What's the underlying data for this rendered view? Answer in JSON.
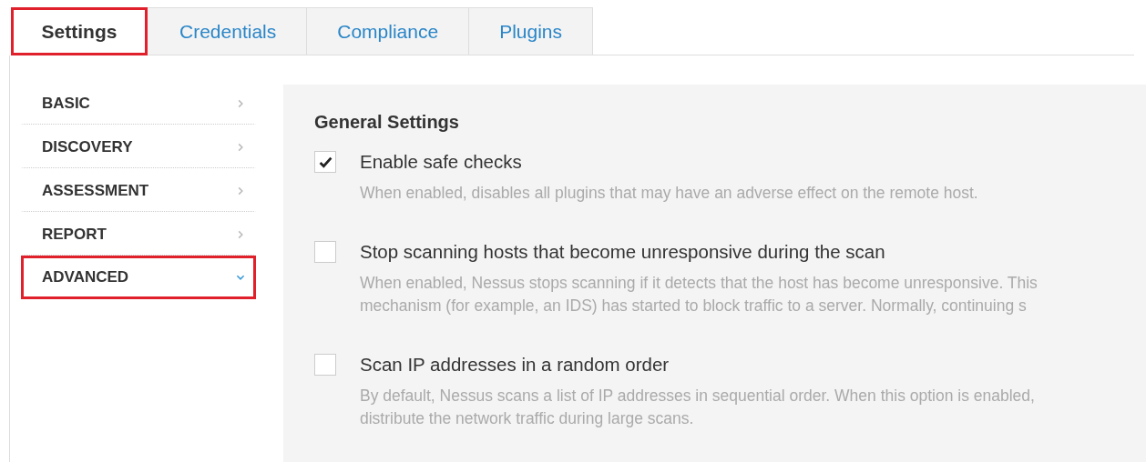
{
  "tabs": [
    {
      "label": "Settings",
      "selected": true,
      "highlighted": true
    },
    {
      "label": "Credentials",
      "selected": false,
      "highlighted": false
    },
    {
      "label": "Compliance",
      "selected": false,
      "highlighted": false
    },
    {
      "label": "Plugins",
      "selected": false,
      "highlighted": false
    }
  ],
  "sidebar": {
    "items": [
      {
        "label": "BASIC",
        "expanded": false,
        "highlighted": false
      },
      {
        "label": "DISCOVERY",
        "expanded": false,
        "highlighted": false
      },
      {
        "label": "ASSESSMENT",
        "expanded": false,
        "highlighted": false
      },
      {
        "label": "REPORT",
        "expanded": false,
        "highlighted": false
      },
      {
        "label": "ADVANCED",
        "expanded": true,
        "highlighted": true
      }
    ]
  },
  "panel": {
    "heading": "General Settings",
    "options": [
      {
        "label": "Enable safe checks",
        "checked": true,
        "description": [
          "When enabled, disables all plugins that may have an adverse effect on the remote host."
        ]
      },
      {
        "label": "Stop scanning hosts that become unresponsive during the scan",
        "checked": false,
        "description": [
          "When enabled, Nessus stops scanning if it detects that the host has become unresponsive. This",
          "mechanism (for example, an IDS) has started to block traffic to a server. Normally, continuing s"
        ]
      },
      {
        "label": "Scan IP addresses in a random order",
        "checked": false,
        "description": [
          "By default, Nessus scans a list of IP addresses in sequential order. When this option is enabled,",
          "distribute the network traffic during large scans."
        ]
      }
    ]
  }
}
